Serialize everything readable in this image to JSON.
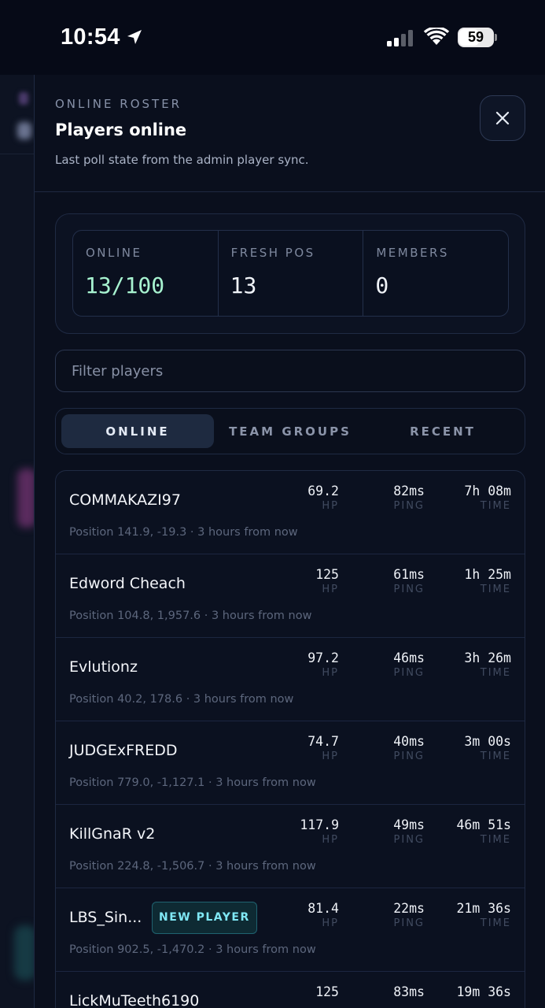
{
  "status_bar": {
    "time": "10:54",
    "battery": "59"
  },
  "roster": {
    "eyebrow": "ONLINE ROSTER",
    "title": "Players online",
    "subtitle": "Last poll state from the admin player sync."
  },
  "stats": [
    {
      "label": "ONLINE",
      "value": "13/100"
    },
    {
      "label": "FRESH POS",
      "value": "13"
    },
    {
      "label": "MEMBERS",
      "value": "0"
    }
  ],
  "filter": {
    "placeholder": "Filter players",
    "value": ""
  },
  "tabs": [
    {
      "label": "ONLINE",
      "active": true
    },
    {
      "label": "TEAM GROUPS",
      "active": false
    },
    {
      "label": "RECENT",
      "active": false
    }
  ],
  "metric_labels": {
    "hp": "HP",
    "ping": "PING",
    "time": "TIME"
  },
  "players": [
    {
      "name": "COMMAKAZI97",
      "hp": "69.2",
      "ping": "82ms",
      "time": "7h 08m",
      "position": "Position 141.9, -19.3 · 3 hours from now"
    },
    {
      "name": "Edword Cheach",
      "hp": "125",
      "ping": "61ms",
      "time": "1h 25m",
      "position": "Position 104.8, 1,957.6 · 3 hours from now"
    },
    {
      "name": "Evlutionz",
      "hp": "97.2",
      "ping": "46ms",
      "time": "3h 26m",
      "position": "Position 40.2, 178.6 · 3 hours from now"
    },
    {
      "name": "JUDGExFREDD",
      "hp": "74.7",
      "ping": "40ms",
      "time": "3m 00s",
      "position": "Position 779.0, -1,127.1 · 3 hours from now"
    },
    {
      "name": "KillGnaR v2",
      "hp": "117.9",
      "ping": "49ms",
      "time": "46m 51s",
      "position": "Position 224.8, -1,506.7 · 3 hours from now"
    },
    {
      "name": "LBS_Sin...",
      "badge": "NEW PLAYER",
      "hp": "81.4",
      "ping": "22ms",
      "time": "21m 36s",
      "position": "Position 902.5, -1,470.2 · 3 hours from now"
    },
    {
      "name": "LickMuTeeth6190",
      "hp": "125",
      "ping": "83ms",
      "time": "19m 36s",
      "position": ""
    }
  ],
  "colors": {
    "accent": "#a7f3d0",
    "badge": "#7fe8f5",
    "background": "#0a0f1d"
  }
}
